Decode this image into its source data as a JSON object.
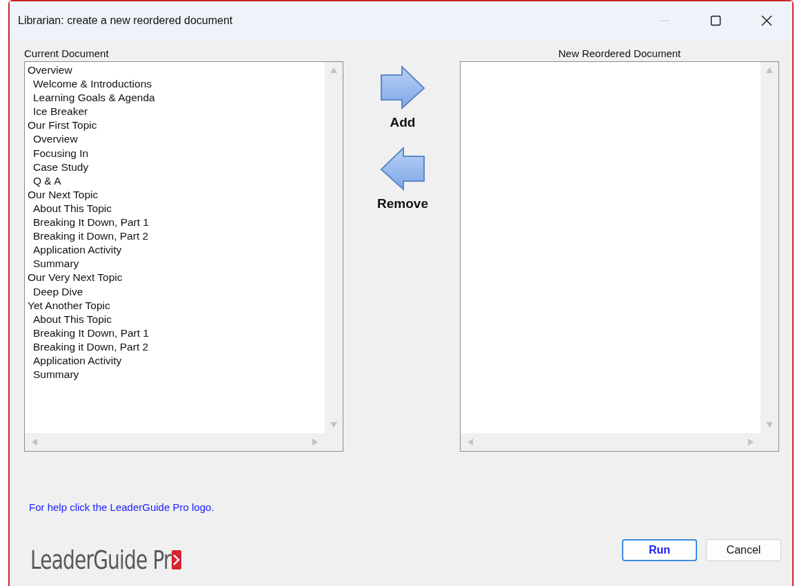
{
  "window": {
    "title": "Librarian: create a new reordered document",
    "minimize_disabled": true
  },
  "current_document": {
    "label": "Current Document",
    "items": [
      {
        "label": "Overview",
        "children": [
          {
            "label": "Welcome & Introductions"
          },
          {
            "label": "Learning Goals & Agenda"
          },
          {
            "label": "Ice Breaker"
          }
        ]
      },
      {
        "label": "Our First Topic",
        "children": [
          {
            "label": "Overview"
          },
          {
            "label": "Focusing In"
          },
          {
            "label": "Case Study"
          },
          {
            "label": "Q & A"
          }
        ]
      },
      {
        "label": "Our Next Topic",
        "children": [
          {
            "label": "About This Topic"
          },
          {
            "label": "Breaking It Down, Part 1"
          },
          {
            "label": "Breaking it Down, Part 2"
          },
          {
            "label": "Application Activity"
          },
          {
            "label": "Summary"
          }
        ]
      },
      {
        "label": "Our Very Next Topic",
        "children": [
          {
            "label": "Deep Dive"
          }
        ]
      },
      {
        "label": "Yet Another Topic",
        "children": [
          {
            "label": "About This Topic"
          },
          {
            "label": "Breaking It Down, Part 1"
          },
          {
            "label": "Breaking it Down, Part 2"
          },
          {
            "label": "Application Activity"
          },
          {
            "label": "Summary"
          }
        ]
      }
    ]
  },
  "actions": [
    {
      "label": "Add",
      "kind": "right"
    },
    {
      "label": "Remove",
      "kind": "left"
    }
  ],
  "new_document": {
    "label": "New Reordered Document"
  },
  "help_text": "For help click the LeaderGuide Pro logo.",
  "logo": {
    "text": "LeaderGuide Pr"
  },
  "buttons": [
    {
      "label": "Run",
      "default": true
    },
    {
      "label": "Cancel",
      "default": false
    }
  ]
}
